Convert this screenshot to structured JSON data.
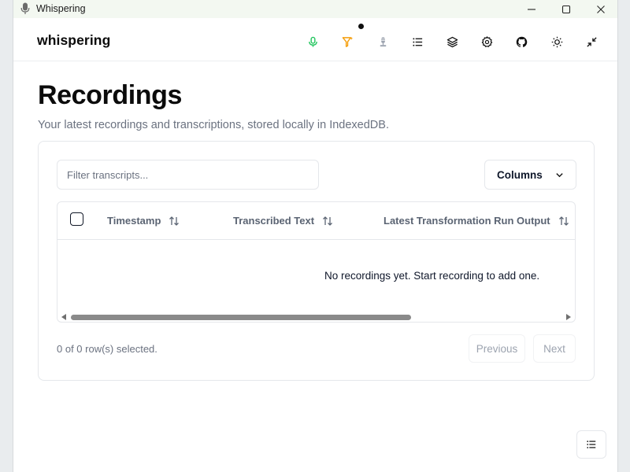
{
  "window": {
    "title": "Whispering",
    "controls": [
      "minimize-icon",
      "maximize-icon",
      "close-icon"
    ]
  },
  "header": {
    "brand": "whispering",
    "icons": [
      "microphone-icon",
      "filter-icon",
      "mic-stand-icon",
      "list-icon",
      "layers-icon",
      "settings-icon",
      "github-icon",
      "sun-icon",
      "minimize-arrows-icon"
    ],
    "colors": {
      "mic": "#22c55e",
      "filter": "#f59e0b"
    }
  },
  "page": {
    "title": "Recordings",
    "subtitle": "Your latest recordings and transcriptions, stored locally in IndexedDB."
  },
  "toolbar": {
    "filter_placeholder": "Filter transcripts...",
    "columns_label": "Columns"
  },
  "table": {
    "columns": [
      {
        "label": "Timestamp"
      },
      {
        "label": "Transcribed Text"
      },
      {
        "label": "Latest Transformation Run Output"
      }
    ],
    "empty_message": "No recordings yet. Start recording to add one."
  },
  "footer": {
    "selected_text": "0 of 0 row(s) selected.",
    "previous_label": "Previous",
    "next_label": "Next"
  }
}
